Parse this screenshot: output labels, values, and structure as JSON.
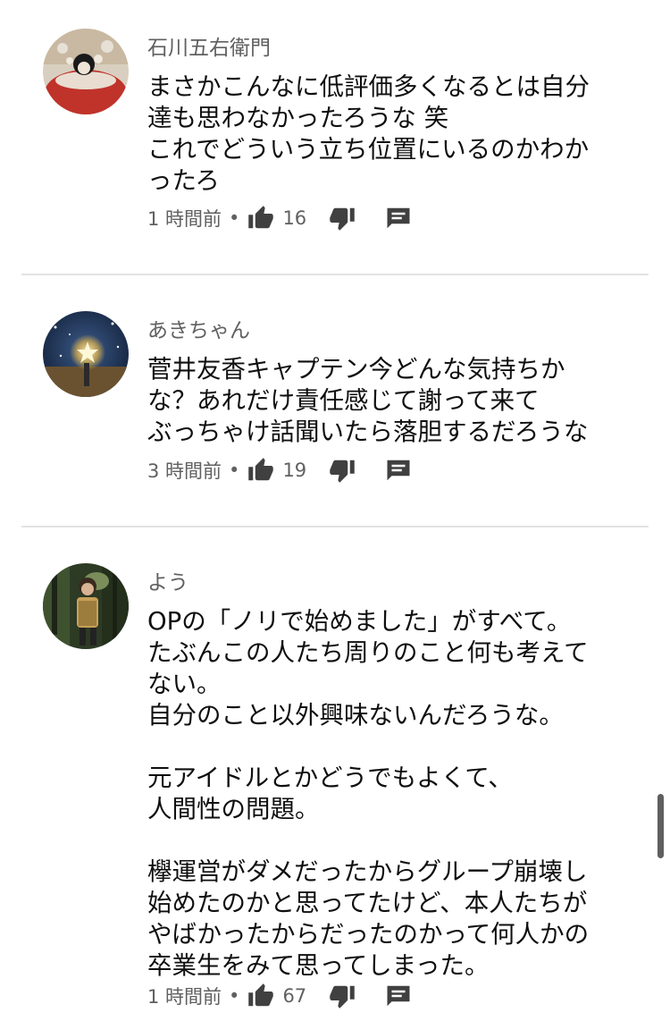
{
  "comments": [
    {
      "author": "石川五右衛門",
      "lines": [
        "まさかこんなに低評価多くなるとは自分",
        "達も思わなかったろうな 笑",
        "これでどういう立ち位置にいるのかわか",
        "ったろ"
      ],
      "time": "1 時間前",
      "separator": "•",
      "likes": "16"
    },
    {
      "author": "あきちゃん",
      "lines": [
        "菅井友香キャプテン今どんな気持ちか",
        "な？あれだけ責任感じて謝って来て",
        "ぶっちゃけ話聞いたら落胆するだろうな"
      ],
      "time": "3 時間前",
      "separator": "•",
      "likes": "19"
    },
    {
      "author": "よう",
      "lines": [
        "OPの「ノリで始めました」がすべて。",
        "たぶんこの人たち周りのこと何も考えて",
        "ない。",
        "自分のこと以外興味ないんだろうな。",
        "",
        "元アイドルとかどうでもよくて、",
        "人間性の問題。",
        "",
        "欅運営がダメだったからグループ崩壊し",
        "始めたのかと思ってたけど、本人たちが",
        "やばかったからだったのかって何人かの",
        "卒業生をみて思ってしまった。"
      ],
      "time": "1 時間前",
      "separator": "•",
      "likes": "67"
    }
  ],
  "icons": {
    "like": "thumb-up-icon",
    "dislike": "thumb-down-icon",
    "reply": "comment-reply-icon"
  },
  "colors": {
    "text": "#0f0f0f",
    "meta": "#606060",
    "icon": "#404040",
    "divider": "#e3e3e3"
  }
}
